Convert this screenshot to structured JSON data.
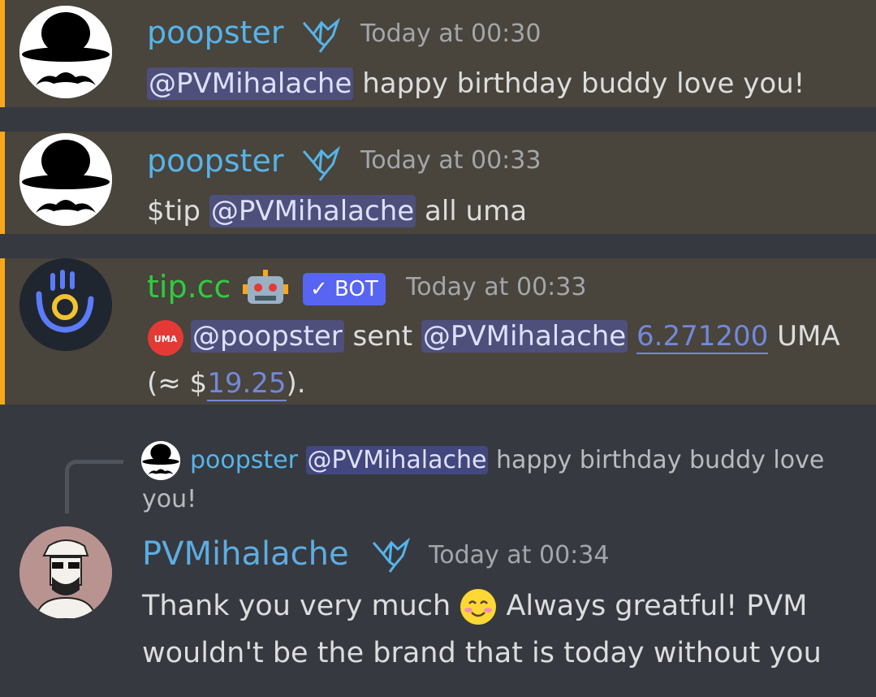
{
  "messages": [
    {
      "author": "poopster",
      "timestamp": "Today at 00:30",
      "mention": "@PVMihalache",
      "text": "happy birthday buddy love you!"
    },
    {
      "author": "poopster",
      "timestamp": "Today at 00:33",
      "prefix": "$tip",
      "mention": "@PVMihalache",
      "text": "all uma"
    },
    {
      "author": "tip.cc",
      "badge": "✓ BOT",
      "timestamp": "Today at 00:33",
      "token_icon_label": "UMA",
      "mention_from": "@poopster",
      "sent": "sent",
      "mention_to": "@PVMihalache",
      "amount": "6.271200",
      "unit": "UMA",
      "usd_prefix": "(≈ $",
      "usd": "19.25",
      "usd_suffix": ")."
    },
    {
      "reply": {
        "author": "poopster",
        "mention": "@PVMihalache",
        "text_line1": "happy birthday buddy love",
        "text_line2": "you!"
      },
      "author": "PVMihalache",
      "timestamp": "Today at 00:34",
      "text_line1_a": "Thank you very much",
      "text_line1_b": "Always greatful! PVM",
      "text_line2": "wouldn't be the brand that is today without you"
    }
  ],
  "colors": {
    "poopster": "#56b4e9",
    "tipcc": "#2ecc40",
    "pvm": "#5dade2",
    "highlight_bg": "#49443c",
    "highlight_bar": "#faa81a",
    "bot_badge": "#5865f2"
  }
}
